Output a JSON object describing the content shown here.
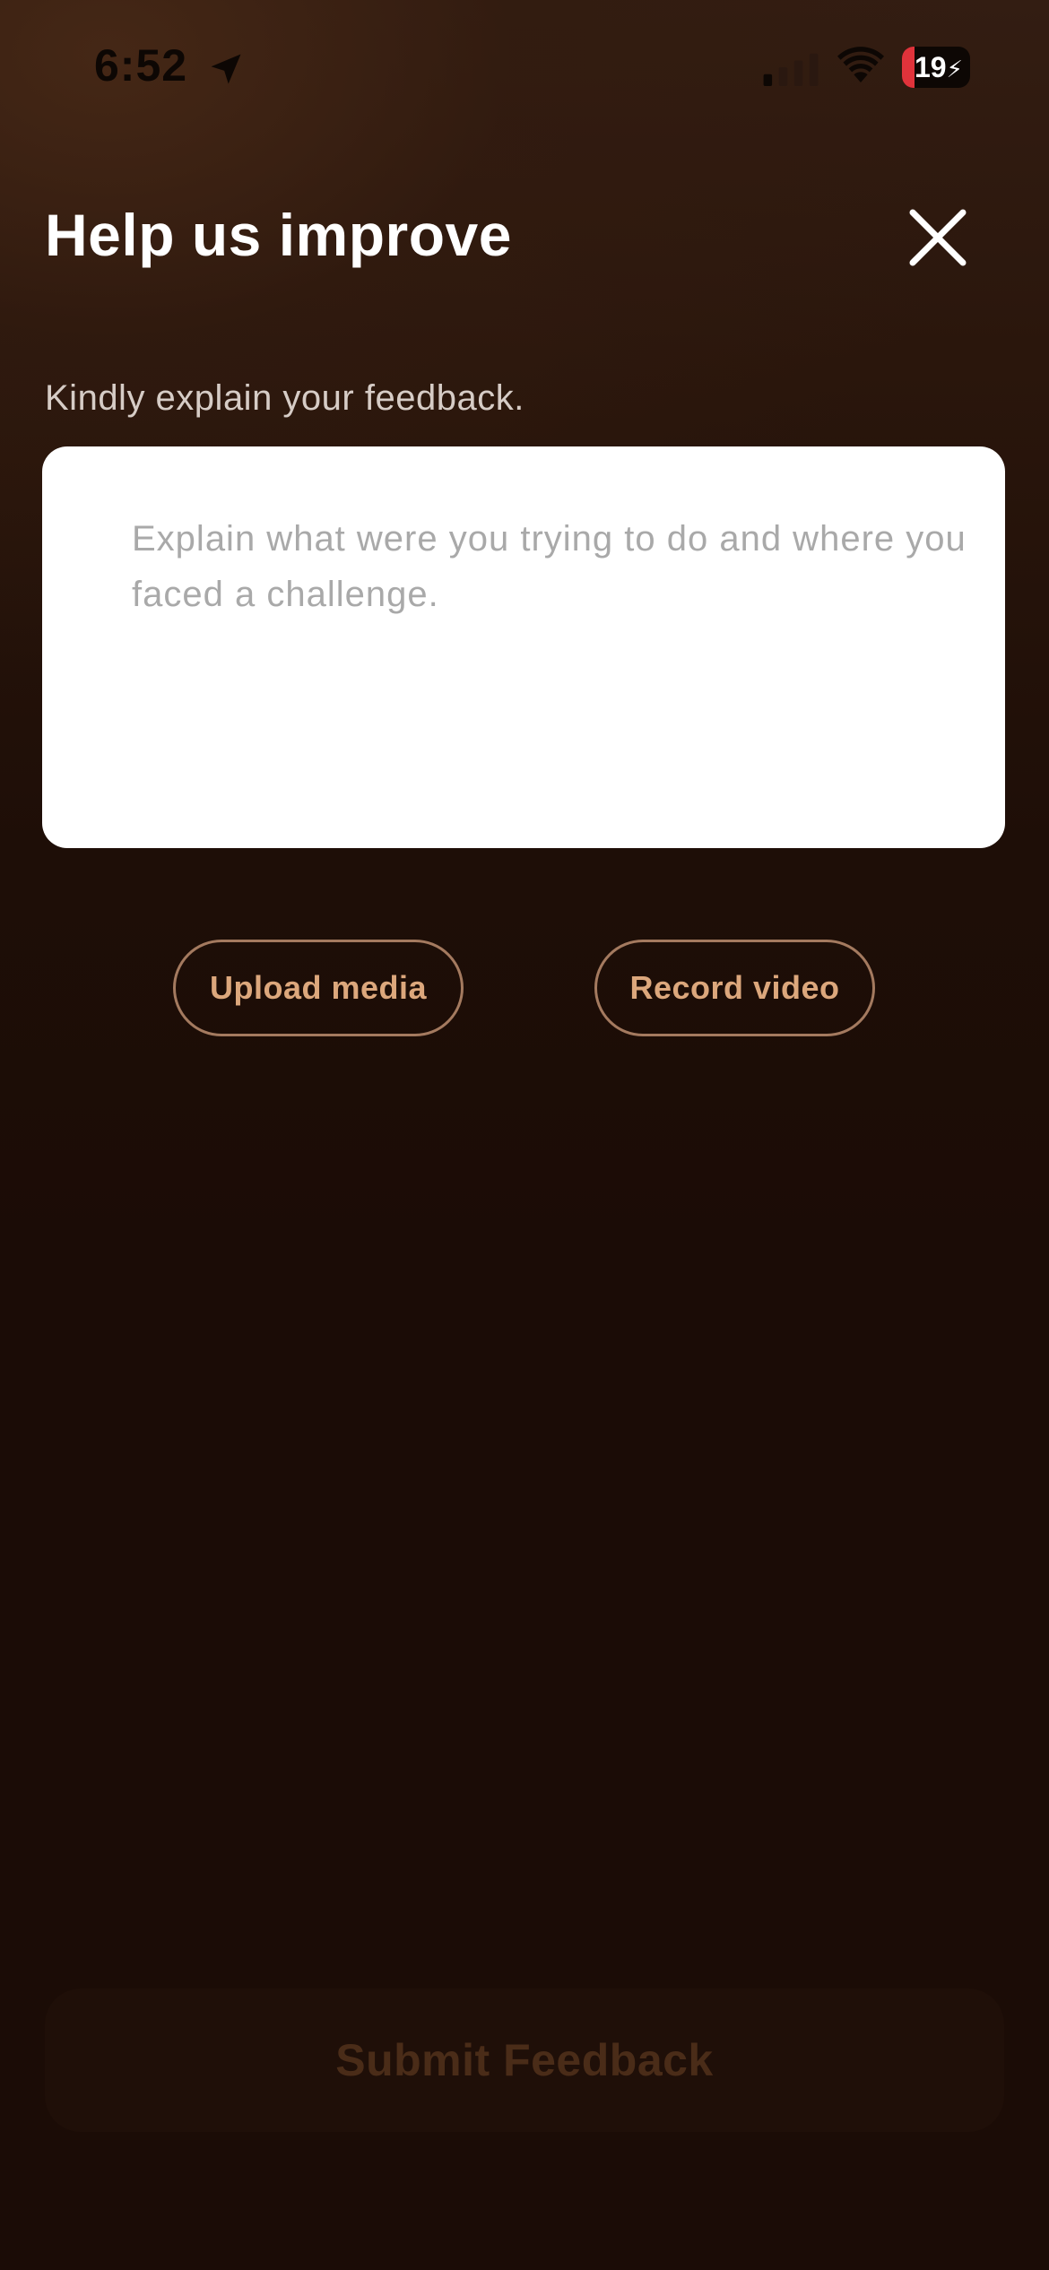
{
  "status_bar": {
    "time": "6:52",
    "battery_level": "19",
    "battery_charging_glyph": "⚡",
    "icons": [
      "location-arrow-icon",
      "cellular-signal-icon",
      "wifi-icon",
      "battery-icon"
    ],
    "battery_fill_fraction": 0.19
  },
  "header": {
    "title": "Help us improve",
    "close_icon": "close-icon"
  },
  "form": {
    "prompt_label": "Kindly explain your feedback.",
    "feedback_placeholder": "Explain what were you trying to do and where you faced a challenge.",
    "feedback_value": "",
    "upload_label": "Upload media",
    "record_label": "Record video"
  },
  "footer": {
    "submit_label": "Submit Feedback",
    "submit_enabled": false
  },
  "colors": {
    "background": "#1b0c06",
    "accent": "#dca77c",
    "accent_border": "#a47a5f",
    "battery_low": "#e0333b",
    "submit_disabled_text": "#4a2c18"
  }
}
